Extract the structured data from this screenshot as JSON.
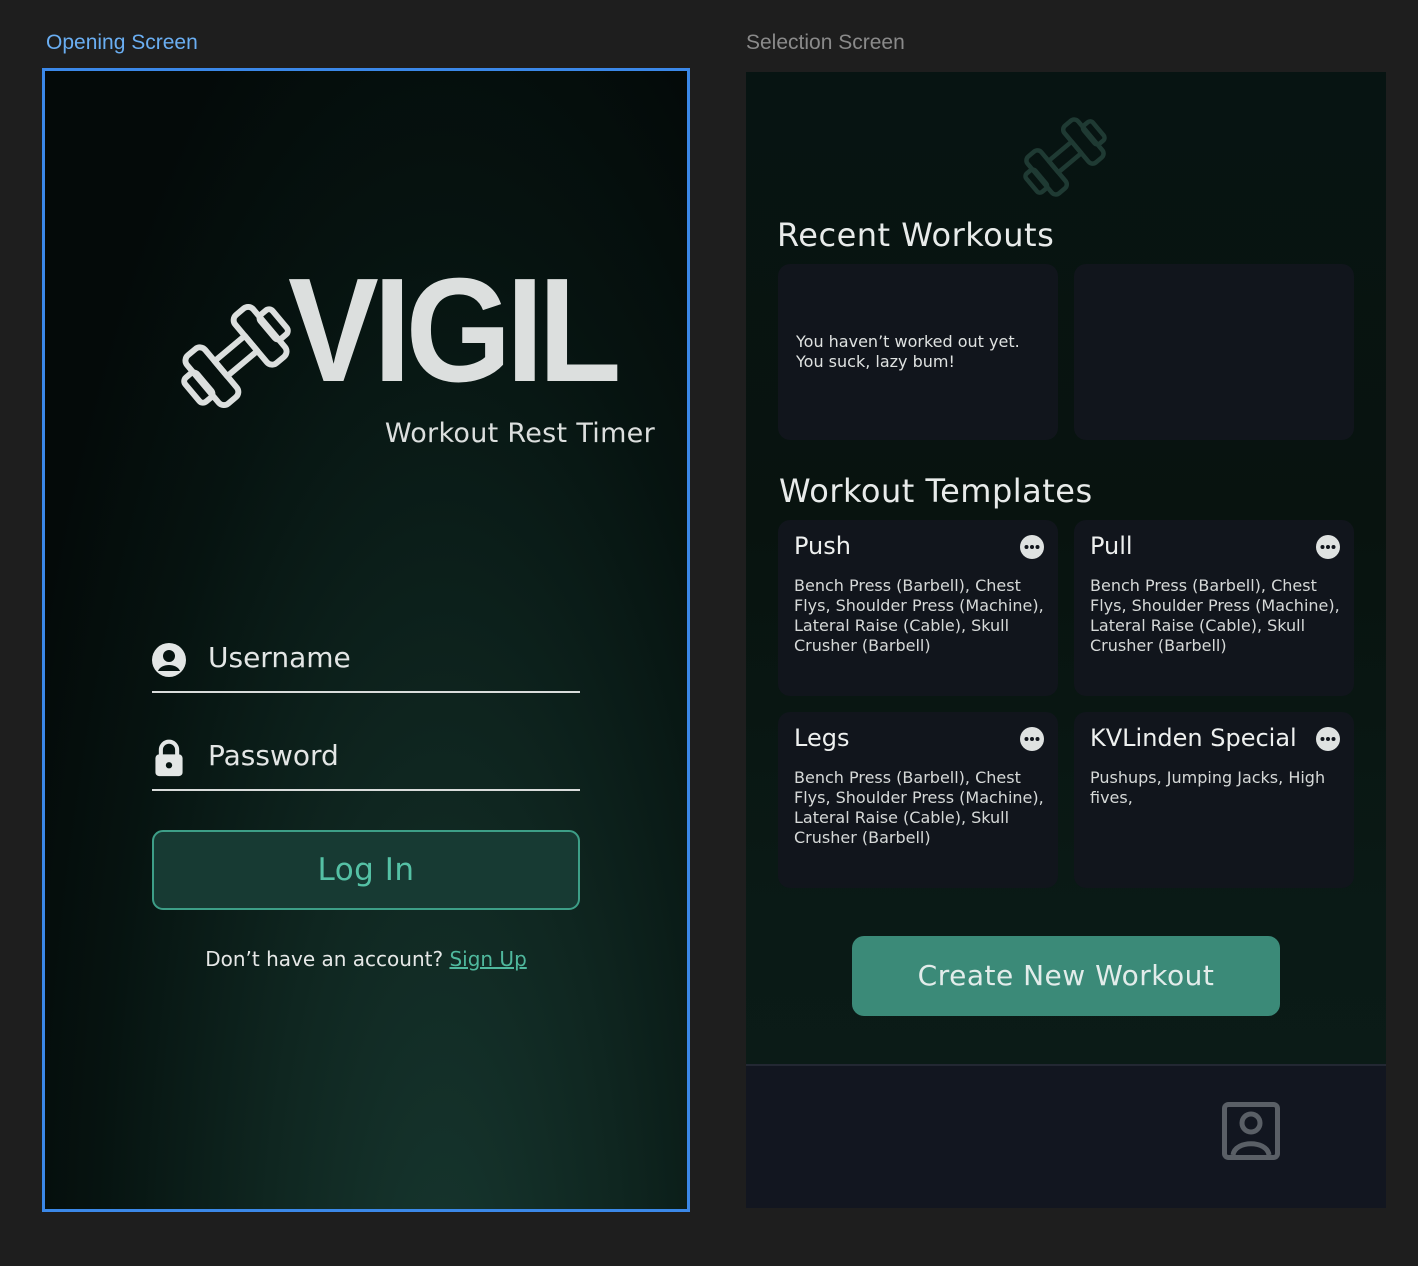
{
  "frames": {
    "opening_label": "Opening Screen",
    "selection_label": "Selection Screen"
  },
  "opening": {
    "brand": "VIGIL",
    "tagline": "Workout Rest Timer",
    "username_placeholder": "Username",
    "password_placeholder": "Password",
    "login_label": "Log In",
    "signup_prompt": "Don’t have an account?",
    "signup_link": "Sign Up"
  },
  "selection": {
    "recent_title": "Recent Workouts",
    "recent_cards": [
      {
        "text": "You haven’t worked out yet. You suck, lazy bum!"
      },
      {
        "text": ""
      }
    ],
    "templates_title": "Workout Templates",
    "templates": [
      {
        "name": "Push",
        "exercises": "Bench Press (Barbell), Chest Flys, Shoulder Press (Machine), Lateral Raise (Cable), Skull Crusher (Barbell)"
      },
      {
        "name": "Pull",
        "exercises": "Bench Press (Barbell), Chest Flys, Shoulder Press (Machine), Lateral Raise (Cable), Skull Crusher (Barbell)"
      },
      {
        "name": "Legs",
        "exercises": "Bench Press (Barbell), Chest Flys, Shoulder Press (Machine), Lateral Raise (Cable), Skull Crusher (Barbell)"
      },
      {
        "name": "KVLinden Special",
        "exercises": "Pushups, Jumping Jacks, High fives,"
      }
    ],
    "create_label": "Create New Workout"
  },
  "icons": {
    "logo": "dumbbell-icon",
    "username": "user-circle-icon",
    "password": "lock-icon",
    "more": "more-options-icon",
    "profile": "profile-icon"
  },
  "colors": {
    "accent": "#4fb89d",
    "create_button": "#3b8a78",
    "card": "#11151c",
    "selected_frame": "#3b88e8"
  }
}
